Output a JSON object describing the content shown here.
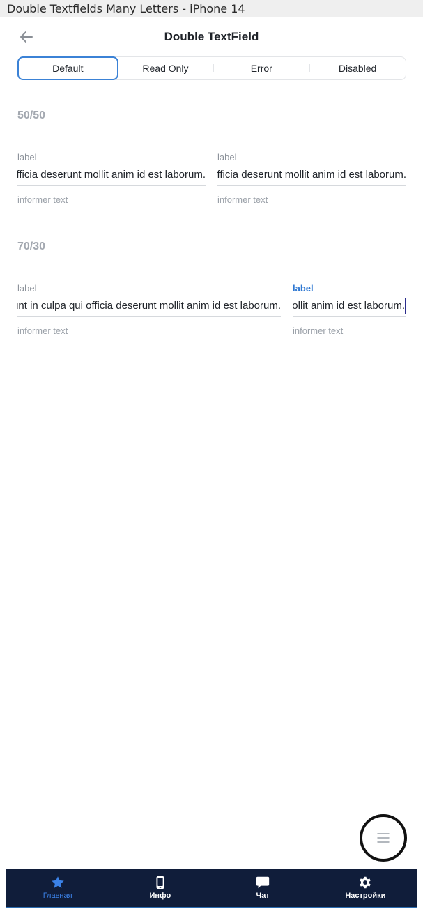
{
  "window": {
    "title": "Double Textfields Many Letters - iPhone 14"
  },
  "header": {
    "title": "Double TextField"
  },
  "segments": [
    {
      "label": "Default",
      "active": true
    },
    {
      "label": "Read Only",
      "active": false
    },
    {
      "label": "Error",
      "active": false
    },
    {
      "label": "Disabled",
      "active": false
    }
  ],
  "sections": [
    {
      "title": "50/50",
      "fields": [
        {
          "label": "label",
          "value": "Excepteur sint occaecat cupidatat non proident, sunt in culpa qui officia deserunt mollit anim id est laborum.",
          "informer": "informer text"
        },
        {
          "label": "label",
          "value": "Excepteur sint occaecat cupidatat non proident, sunt in culpa qui officia deserunt mollit anim id est laborum.",
          "informer": "informer text"
        }
      ]
    },
    {
      "title": "70/30",
      "fields": [
        {
          "label": "label",
          "value": "Excepteur sint occaecat cupidatat non proident, sunt in culpa qui officia deserunt mollit anim id est laborum.",
          "informer": "informer text"
        },
        {
          "label": "label",
          "value": "Excepteur sint occaecat cupidatat non proident, sunt in culpa qui officia deserunt mollit anim id est laborum.",
          "informer": "informer text",
          "focused": true
        }
      ]
    }
  ],
  "tabbar": {
    "items": [
      {
        "label": "Главная",
        "icon": "star-icon",
        "active": true
      },
      {
        "label": "Инфо",
        "icon": "phone-icon",
        "active": false
      },
      {
        "label": "Чат",
        "icon": "chat-bubble-icon",
        "active": false
      },
      {
        "label": "Настройки",
        "icon": "gear-icon",
        "active": false
      }
    ]
  },
  "colors": {
    "accent": "#3b82d6",
    "tabbar_bg": "#101d3a",
    "section_title": "#a3a8b0",
    "label": "#8d939b",
    "focused_label": "#2f78d2"
  },
  "fab": {
    "icon": "menu-icon"
  }
}
